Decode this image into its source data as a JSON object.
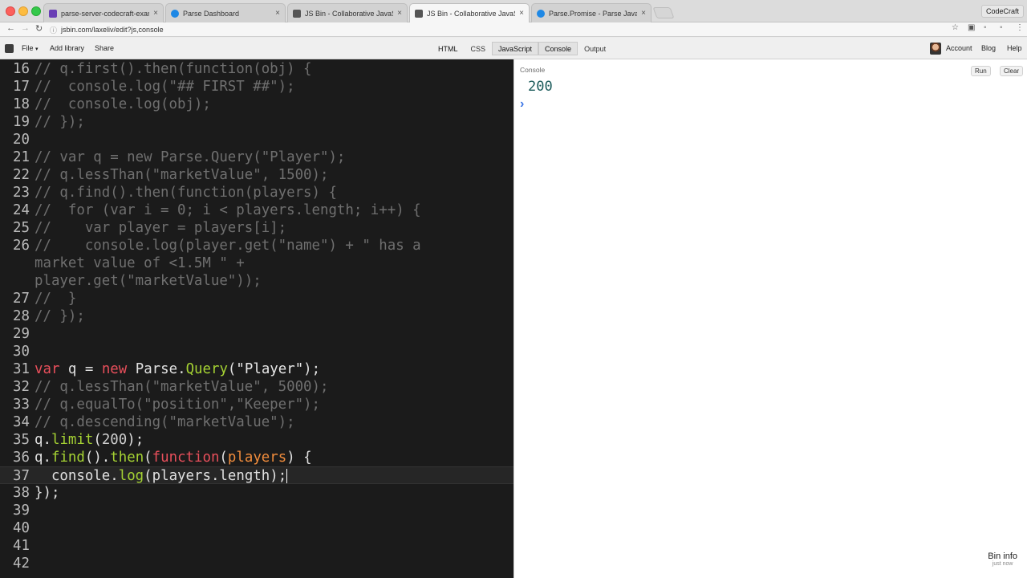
{
  "browser": {
    "tabs": [
      {
        "label": "parse-server-codecraft-exam",
        "favicon_color": "#6a3fb5",
        "active": false
      },
      {
        "label": "Parse Dashboard",
        "favicon_color": "#1e88e5",
        "active": false
      },
      {
        "label": "JS Bin - Collaborative JavaSc",
        "favicon_color": "#555555",
        "active": false
      },
      {
        "label": "JS Bin - Collaborative JavaSc",
        "favicon_color": "#555555",
        "active": true
      },
      {
        "label": "Parse.Promise - Parse JavaSc",
        "favicon_color": "#1e88e5",
        "active": false
      }
    ],
    "profile_label": "CodeCraft",
    "url": "jsbin.com/laxeliv/edit?js,console"
  },
  "jsbin": {
    "menu": {
      "file": "File",
      "file_caret": "▾",
      "add_library": "Add library",
      "share": "Share"
    },
    "panels": [
      {
        "label": "HTML",
        "on": false
      },
      {
        "label": "CSS",
        "on": false
      },
      {
        "label": "JavaScript",
        "on": true
      },
      {
        "label": "Console",
        "on": true
      },
      {
        "label": "Output",
        "on": false
      }
    ],
    "right_links": {
      "account": "Account",
      "blog": "Blog",
      "help": "Help"
    }
  },
  "editor": {
    "lines": [
      {
        "n": "16",
        "code": "// q.first().then(function(obj) {"
      },
      {
        "n": "17",
        "code": "//  console.log(\"## FIRST ##\");"
      },
      {
        "n": "18",
        "code": "//  console.log(obj);"
      },
      {
        "n": "19",
        "code": "// });"
      },
      {
        "n": "20",
        "code": ""
      },
      {
        "n": "21",
        "code": "// var q = new Parse.Query(\"Player\");"
      },
      {
        "n": "22",
        "code": "// q.lessThan(\"marketValue\", 1500);"
      },
      {
        "n": "23",
        "code": "// q.find().then(function(players) {"
      },
      {
        "n": "24",
        "code": "//  for (var i = 0; i < players.length; i++) {"
      },
      {
        "n": "25",
        "code": "//    var player = players[i];"
      },
      {
        "n": "26",
        "code": "//    console.log(player.get(\"name\") + \" has a"
      },
      {
        "n": "",
        "code": "market value of <1.5M \" +"
      },
      {
        "n": "",
        "code": "player.get(\"marketValue\"));"
      },
      {
        "n": "27",
        "code": "//  }"
      },
      {
        "n": "28",
        "code": "// });"
      },
      {
        "n": "29",
        "code": ""
      },
      {
        "n": "30",
        "code": ""
      },
      {
        "n": "31",
        "code": "var q = new Parse.Query(\"Player\");"
      },
      {
        "n": "32",
        "code": "// q.lessThan(\"marketValue\", 5000);"
      },
      {
        "n": "33",
        "code": "// q.equalTo(\"position\",\"Keeper\");"
      },
      {
        "n": "34",
        "code": "// q.descending(\"marketValue\");"
      },
      {
        "n": "35",
        "code": "q.limit(200);"
      },
      {
        "n": "36",
        "code": "q.find().then(function(players) {"
      },
      {
        "n": "37",
        "code": "  console.log(players.length);"
      },
      {
        "n": "38",
        "code": "});"
      },
      {
        "n": "39",
        "code": ""
      },
      {
        "n": "40",
        "code": ""
      },
      {
        "n": "41",
        "code": ""
      },
      {
        "n": "42",
        "code": ""
      }
    ],
    "colors": {
      "keyword": "#e84f5b",
      "function": "#a5d233",
      "comment": "#6f6f6f",
      "argument": "#f08c3c"
    }
  },
  "console": {
    "title": "Console",
    "run_label": "Run",
    "clear_label": "Clear",
    "output": "200",
    "prompt_glyph": "›"
  },
  "bin_info": {
    "title": "Bin info",
    "subtitle": "just now"
  }
}
